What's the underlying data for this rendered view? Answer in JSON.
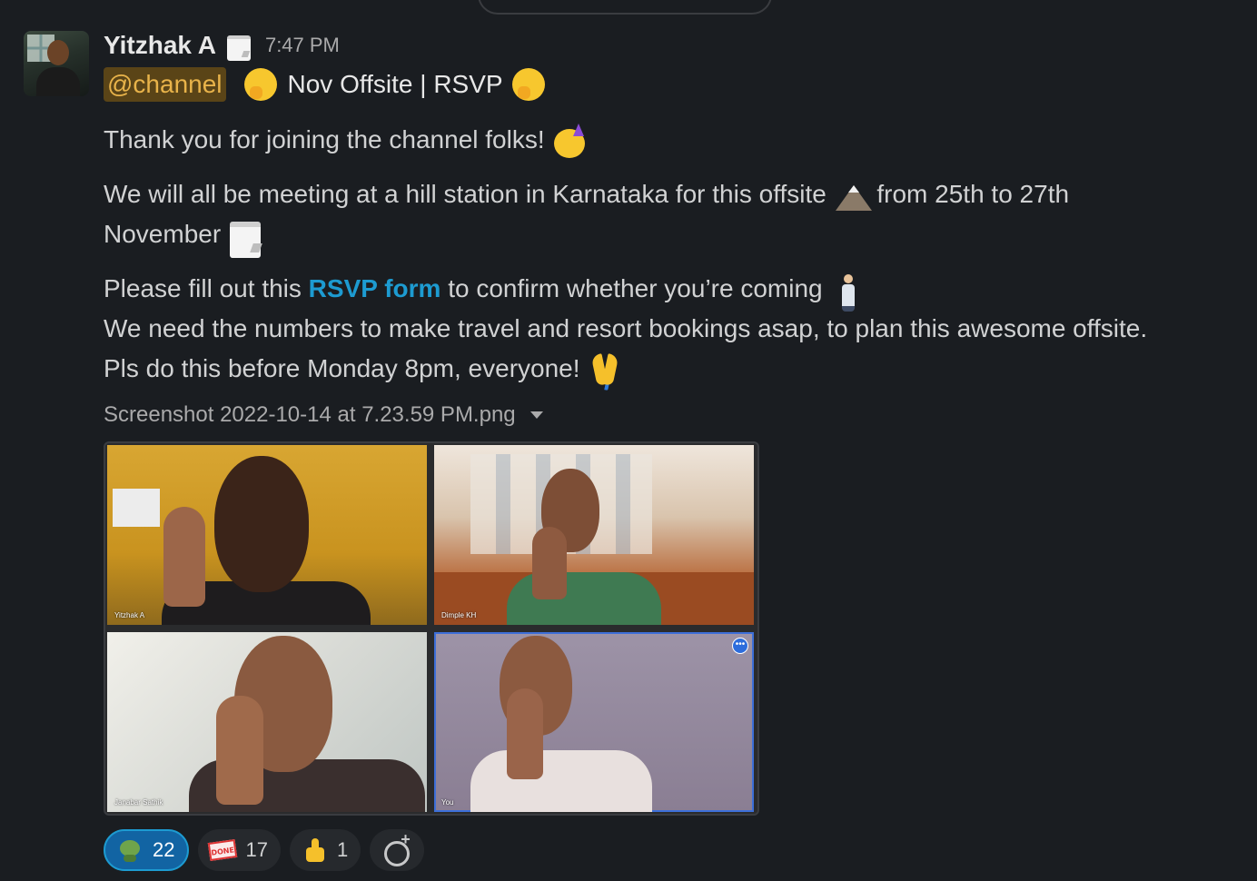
{
  "message": {
    "author": "Yitzhak A",
    "status_emoji": "calendar-icon",
    "time": "7:47 PM",
    "mention": "@channel",
    "title": "Nov Offsite | RSVP",
    "lines": {
      "thanks": "Thank you for joining the channel folks!",
      "meet_part1": "We will all be meeting at a hill station in Karnataka for this offsite",
      "meet_part2": "from 25th to 27th",
      "meet_part3": "November",
      "rsvp_part1": "Please fill out this",
      "rsvp_link": "RSVP form",
      "rsvp_part2": "to confirm whether you’re coming",
      "numbers": "We need the numbers to make travel and resort bookings asap, to plan this awesome offsite.",
      "deadline": "Pls do this before Monday 8pm, everyone!"
    }
  },
  "attachment": {
    "filename": "Screenshot 2022-10-14 at 7.23.59 PM.png",
    "tiles": [
      {
        "label": "Yitzhak A"
      },
      {
        "label": "Dimple KH"
      },
      {
        "label": "Janabar Sathik"
      },
      {
        "label": "You"
      }
    ]
  },
  "reactions": [
    {
      "icon": "frog-icon",
      "count": "22",
      "active": true
    },
    {
      "icon": "done-stamp-icon",
      "count": "17",
      "active": false
    },
    {
      "icon": "thumbs-up-icon",
      "count": "1",
      "active": false
    }
  ],
  "add_reaction_icon": "add-reaction-icon",
  "colors": {
    "background": "#1a1d21",
    "link": "#1d9bd1",
    "mention_bg": "#5a4417",
    "mention_fg": "#e8b34a",
    "reaction_active": "#1264a3"
  }
}
